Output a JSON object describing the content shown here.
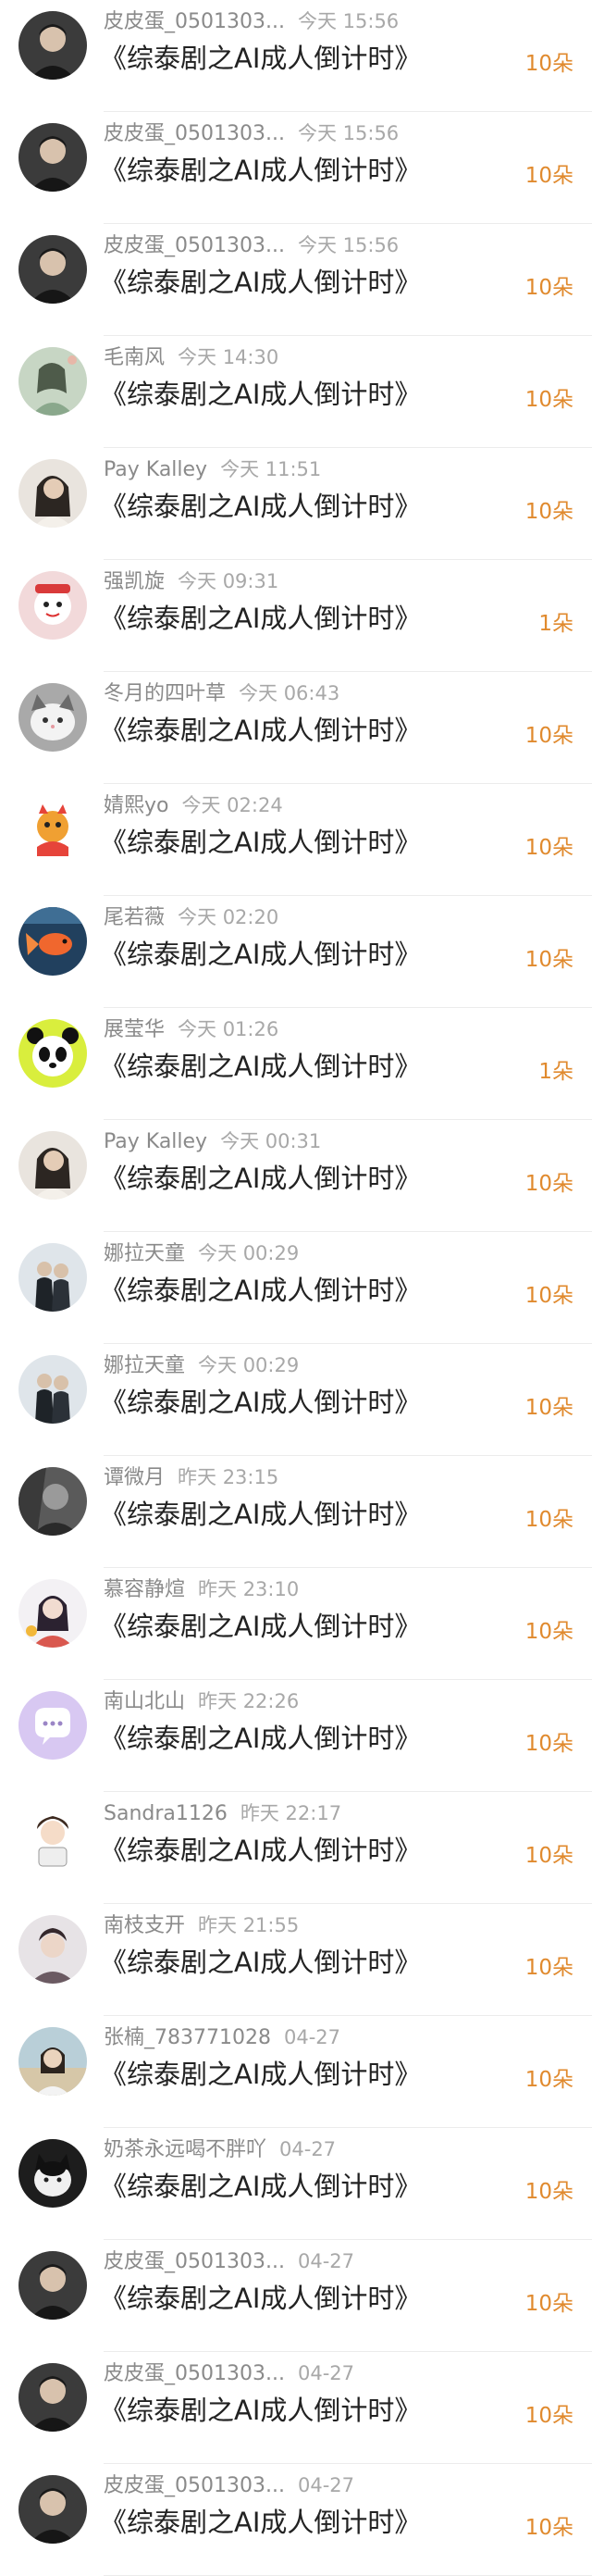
{
  "accent_color": "#e08a2e",
  "items": [
    {
      "name": "皮皮蛋_0501303...",
      "time": "今天 15:56",
      "title": "《综泰剧之AI成人倒计时》",
      "count": "10朵",
      "avatar_icon": "avatar-man-dark"
    },
    {
      "name": "皮皮蛋_0501303...",
      "time": "今天 15:56",
      "title": "《综泰剧之AI成人倒计时》",
      "count": "10朵",
      "avatar_icon": "avatar-man-dark"
    },
    {
      "name": "皮皮蛋_0501303...",
      "time": "今天 15:56",
      "title": "《综泰剧之AI成人倒计时》",
      "count": "10朵",
      "avatar_icon": "avatar-man-dark"
    },
    {
      "name": "毛南风",
      "time": "今天 14:30",
      "title": "《综泰剧之AI成人倒计时》",
      "count": "10朵",
      "avatar_icon": "avatar-painting"
    },
    {
      "name": "Pay Kalley",
      "time": "今天 11:51",
      "title": "《综泰剧之AI成人倒计时》",
      "count": "10朵",
      "avatar_icon": "avatar-woman"
    },
    {
      "name": "强凯旋",
      "time": "今天 09:31",
      "title": "《综泰剧之AI成人倒计时》",
      "count": "1朵",
      "avatar_icon": "avatar-cartoon-red"
    },
    {
      "name": "冬月的四叶草",
      "time": "今天 06:43",
      "title": "《综泰剧之AI成人倒计时》",
      "count": "10朵",
      "avatar_icon": "avatar-cat"
    },
    {
      "name": "婧熙yo",
      "time": "今天 02:24",
      "title": "《综泰剧之AI成人倒计时》",
      "count": "10朵",
      "avatar_icon": "avatar-dragon"
    },
    {
      "name": "尾若薇",
      "time": "今天 02:20",
      "title": "《综泰剧之AI成人倒计时》",
      "count": "10朵",
      "avatar_icon": "avatar-goldfish"
    },
    {
      "name": "展莹华",
      "time": "今天 01:26",
      "title": "《综泰剧之AI成人倒计时》",
      "count": "1朵",
      "avatar_icon": "avatar-panda"
    },
    {
      "name": "Pay Kalley",
      "time": "今天 00:31",
      "title": "《综泰剧之AI成人倒计时》",
      "count": "10朵",
      "avatar_icon": "avatar-woman"
    },
    {
      "name": "娜拉天童",
      "time": "今天 00:29",
      "title": "《综泰剧之AI成人倒计时》",
      "count": "10朵",
      "avatar_icon": "avatar-couple"
    },
    {
      "name": "娜拉天童",
      "time": "今天 00:29",
      "title": "《综泰剧之AI成人倒计时》",
      "count": "10朵",
      "avatar_icon": "avatar-couple"
    },
    {
      "name": "谭微月",
      "time": "昨天 23:15",
      "title": "《综泰剧之AI成人倒计时》",
      "count": "10朵",
      "avatar_icon": "avatar-dark-portrait"
    },
    {
      "name": "慕容静煊",
      "time": "昨天 23:10",
      "title": "《综泰剧之AI成人倒计时》",
      "count": "10朵",
      "avatar_icon": "avatar-girl-snow"
    },
    {
      "name": "南山北山",
      "time": "昨天 22:26",
      "title": "《综泰剧之AI成人倒计时》",
      "count": "10朵",
      "avatar_icon": "avatar-chat-bubble"
    },
    {
      "name": "Sandra1126",
      "time": "昨天 22:17",
      "title": "《综泰剧之AI成人倒计时》",
      "count": "10朵",
      "avatar_icon": "avatar-cartoon-boy"
    },
    {
      "name": "南枝支开",
      "time": "昨天 21:55",
      "title": "《综泰剧之AI成人倒计时》",
      "count": "10朵",
      "avatar_icon": "avatar-man-light"
    },
    {
      "name": "张楠_783771028",
      "time": "04-27",
      "title": "《综泰剧之AI成人倒计时》",
      "count": "10朵",
      "avatar_icon": "avatar-woman-outdoor"
    },
    {
      "name": "奶茶永远喝不胖吖",
      "time": "04-27",
      "title": "《综泰剧之AI成人倒计时》",
      "count": "10朵",
      "avatar_icon": "avatar-cat-dark"
    },
    {
      "name": "皮皮蛋_0501303...",
      "time": "04-27",
      "title": "《综泰剧之AI成人倒计时》",
      "count": "10朵",
      "avatar_icon": "avatar-man-dark"
    },
    {
      "name": "皮皮蛋_0501303...",
      "time": "04-27",
      "title": "《综泰剧之AI成人倒计时》",
      "count": "10朵",
      "avatar_icon": "avatar-man-dark"
    },
    {
      "name": "皮皮蛋_0501303...",
      "time": "04-27",
      "title": "《综泰剧之AI成人倒计时》",
      "count": "10朵",
      "avatar_icon": "avatar-man-dark"
    }
  ]
}
